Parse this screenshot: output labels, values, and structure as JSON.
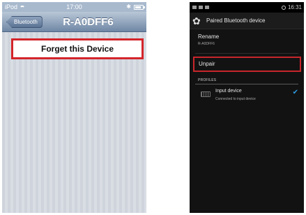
{
  "ios": {
    "status": {
      "carrier": "iPod",
      "time": "17:00"
    },
    "nav": {
      "back_label": "Bluetooth",
      "title": "R-A0DFF6"
    },
    "forget_button": "Forget this Device"
  },
  "android": {
    "status": {
      "right": "16:31"
    },
    "action_bar": {
      "title": "Paired Bluetooth device"
    },
    "rename": {
      "title": "Rename",
      "value": "R-A0DFF6"
    },
    "unpair_label": "Unpair",
    "profiles_header": "PROFILES",
    "profile": {
      "name": "Input device",
      "status": "Connected to input device",
      "checked": true
    },
    "colors": {
      "highlight": "#c8262b",
      "check": "#2e9ae0"
    }
  }
}
